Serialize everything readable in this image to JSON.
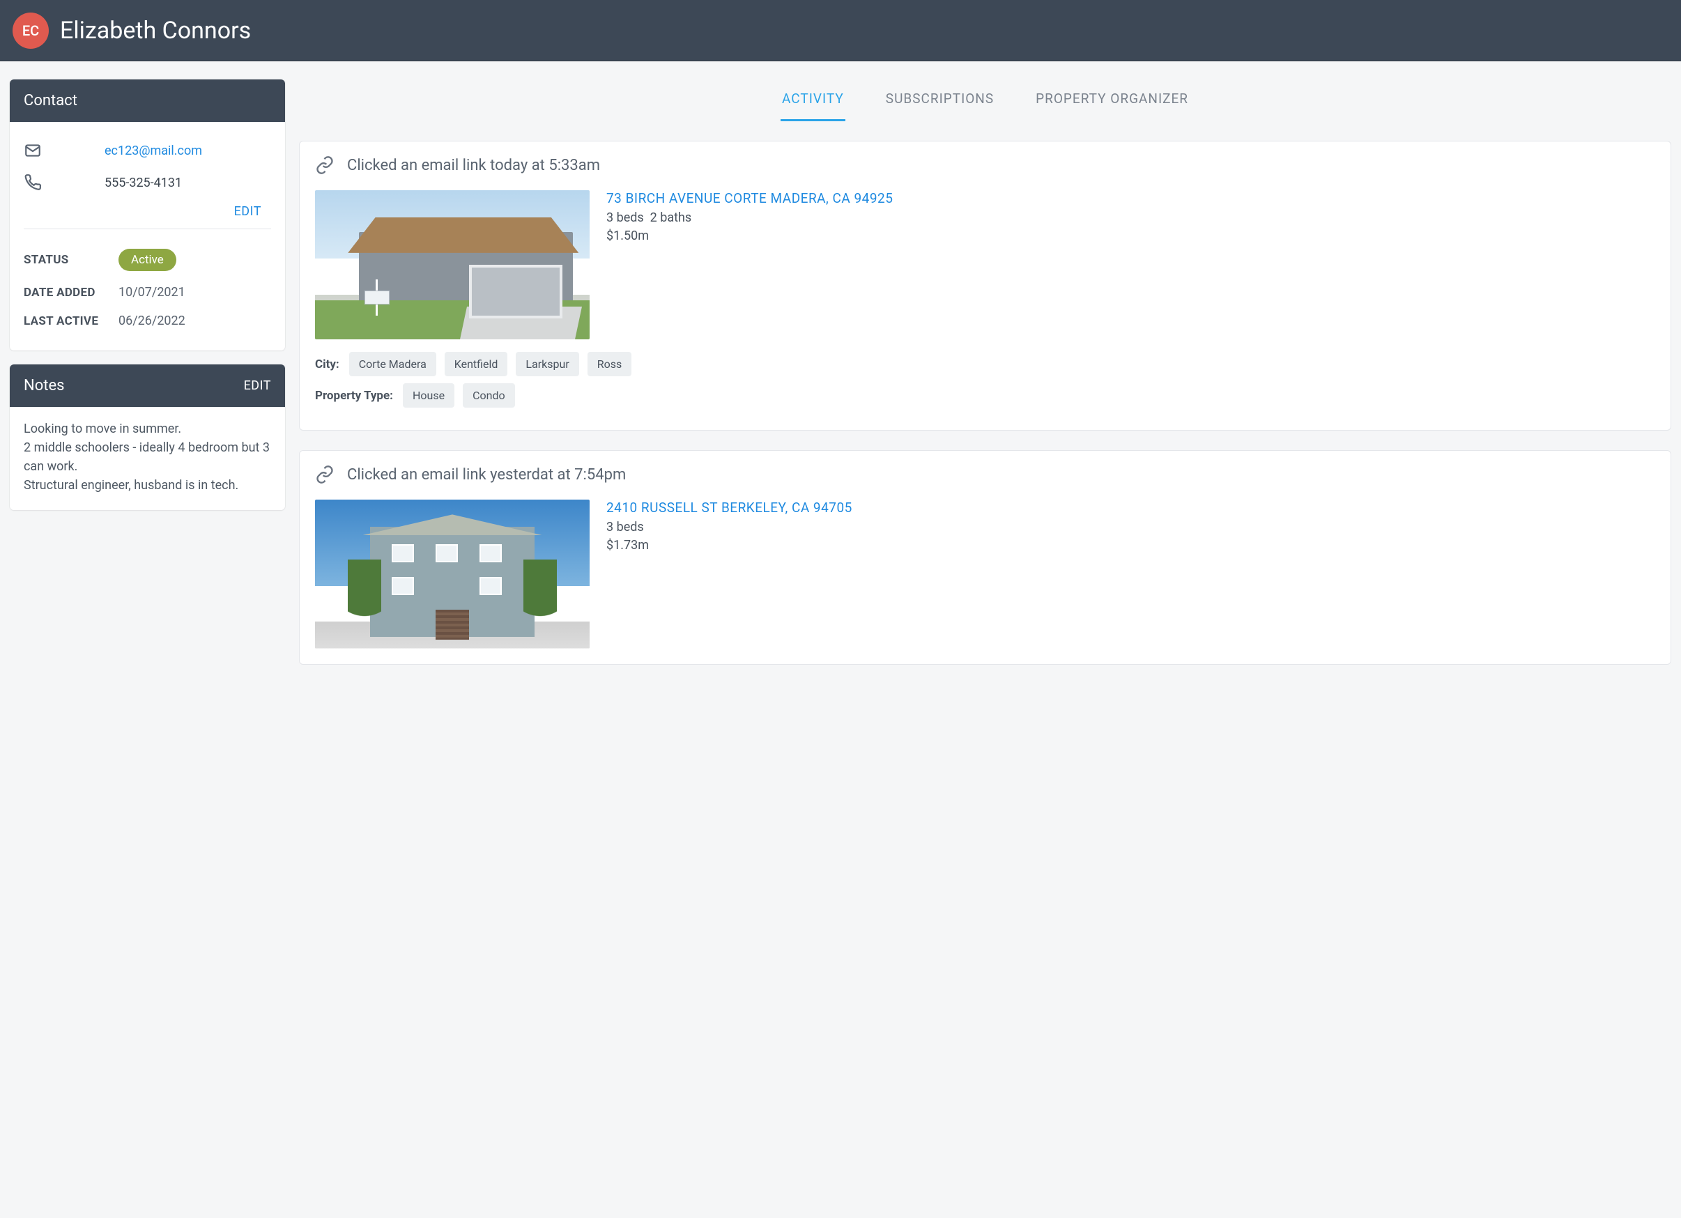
{
  "header": {
    "initials": "EC",
    "name": "Elizabeth Connors"
  },
  "sidebar": {
    "contact": {
      "title": "Contact",
      "email": "ec123@mail.com",
      "phone": "555-325-4131",
      "edit": "EDIT",
      "status_label": "STATUS",
      "status_value": "Active",
      "date_added_label": "DATE ADDED",
      "date_added_value": "10/07/2021",
      "last_active_label": "LAST ACTIVE",
      "last_active_value": "06/26/2022"
    },
    "notes": {
      "title": "Notes",
      "edit": "EDIT",
      "body": "Looking to move in summer.\n2 middle schoolers - ideally 4 bedroom but 3 can work.\nStructural engineer, husband is in tech."
    }
  },
  "tabs": {
    "activity": "ACTIVITY",
    "subscriptions": "SUBSCRIPTIONS",
    "organizer": "PROPERTY ORGANIZER"
  },
  "activity": [
    {
      "event": "Clicked an email link today at 5:33am",
      "address": "73 BIRCH AVENUE CORTE MADERA, CA 94925",
      "beds": "3 beds",
      "baths": "2 baths",
      "price": "$1.50m",
      "city_label": "City:",
      "cities": [
        "Corte Madera",
        "Kentfield",
        "Larkspur",
        "Ross"
      ],
      "type_label": "Property Type:",
      "types": [
        "House",
        "Condo"
      ]
    },
    {
      "event": "Clicked an email link yesterdat at 7:54pm",
      "address": "2410 RUSSELL ST BERKELEY, CA 94705",
      "beds": "3 beds",
      "baths": "",
      "price": "$1.73m"
    }
  ]
}
